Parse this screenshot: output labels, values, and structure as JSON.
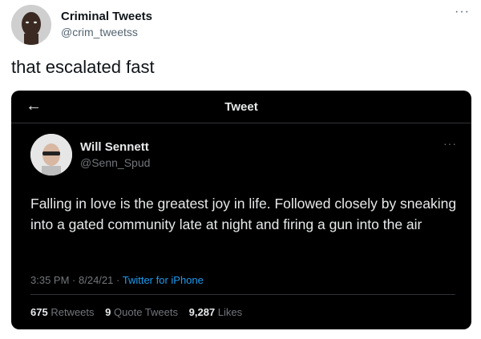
{
  "outer_tweet": {
    "author_name": "Criminal Tweets",
    "author_handle": "@crim_tweetss",
    "more_icon": "more-horizontal-icon",
    "text": "that escalated fast"
  },
  "embedded_tweet": {
    "header_title": "Tweet",
    "back_icon": "back-arrow-icon",
    "author_name": "Will Sennett",
    "author_handle": "@Senn_Spud",
    "text": "Falling in love is the greatest joy in life. Followed closely by sneaking into a gated community late at night and firing a gun into the air",
    "time": "3:35 PM",
    "date": "8/24/21",
    "source": "Twitter for iPhone",
    "retweets_count": "675",
    "retweets_label": "Retweets",
    "quote_count": "9",
    "quote_label": "Quote Tweets",
    "likes_count": "9,287",
    "likes_label": "Likes"
  },
  "colors": {
    "embed_background": "#000000",
    "link_blue": "#1d9bf0",
    "muted_gray": "#71767b"
  }
}
